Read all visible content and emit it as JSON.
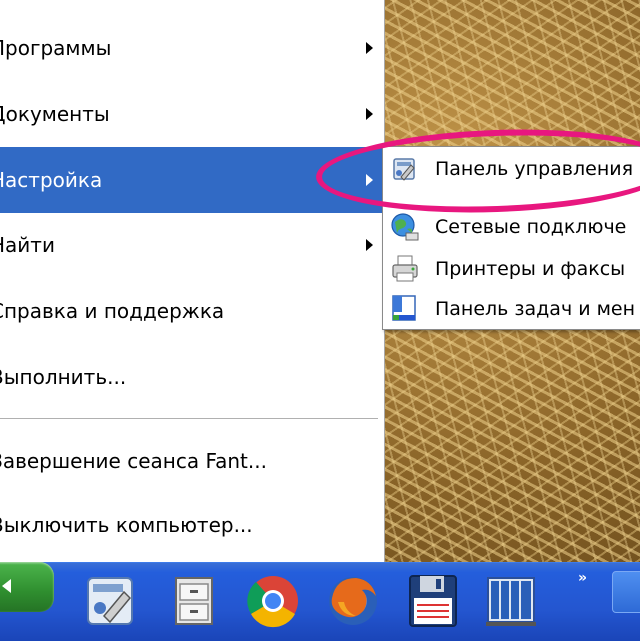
{
  "start_menu": {
    "items": [
      {
        "label": "Программы",
        "has_submenu": true,
        "highlighted": false
      },
      {
        "label": "Документы",
        "has_submenu": true,
        "highlighted": false
      },
      {
        "label": "Настройка",
        "has_submenu": true,
        "highlighted": true
      },
      {
        "label": "Найти",
        "has_submenu": true,
        "highlighted": false
      },
      {
        "label": "Справка и поддержка",
        "has_submenu": false,
        "highlighted": false
      },
      {
        "label": "Выполнить...",
        "has_submenu": false,
        "highlighted": false
      },
      {
        "label": "Завершение сеанса Fant...",
        "has_submenu": false,
        "highlighted": false
      },
      {
        "label": "Выключить компьютер...",
        "has_submenu": false,
        "highlighted": false
      }
    ]
  },
  "settings_submenu": {
    "items": [
      {
        "label": "Панель управления",
        "icon": "control-panel-icon"
      },
      {
        "label": "Сетевые подключе",
        "icon": "network-connections-icon"
      },
      {
        "label": "Принтеры и факсы",
        "icon": "printers-faxes-icon"
      },
      {
        "label": "Панель задач и мен",
        "icon": "taskbar-menu-icon"
      }
    ]
  },
  "taskbar": {
    "tray_overflow": "»",
    "quick_launch": [
      {
        "icon": "control-panel-icon"
      },
      {
        "icon": "file-cabinet-icon"
      },
      {
        "icon": "chrome-icon"
      },
      {
        "icon": "firefox-icon"
      },
      {
        "icon": "floppy-save-icon"
      },
      {
        "icon": "server-rack-icon"
      }
    ]
  },
  "colors": {
    "menu_highlight": "#316ac5",
    "annotation_circle": "#e8177f",
    "taskbar": "#245edc",
    "start_button": "#3a9a3a"
  }
}
